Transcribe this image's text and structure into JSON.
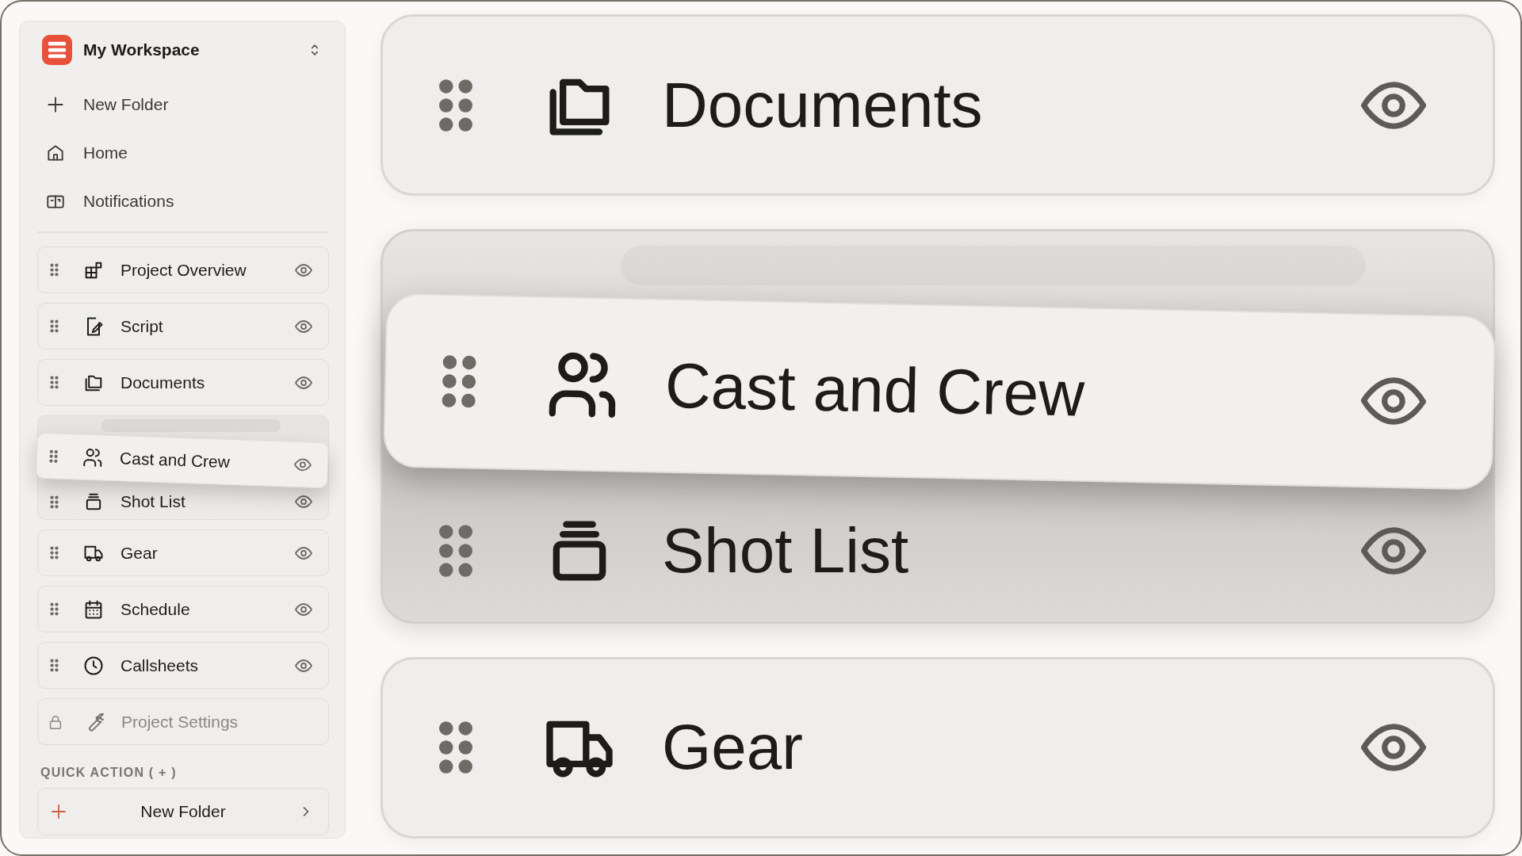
{
  "sidebar": {
    "workspace": {
      "title": "My Workspace"
    },
    "menu": [
      {
        "label": "New Folder"
      },
      {
        "label": "Home"
      },
      {
        "label": "Notifications"
      }
    ],
    "pages": [
      {
        "label": "Project Overview",
        "kind": "item"
      },
      {
        "label": "Script",
        "kind": "item"
      },
      {
        "label": "Documents",
        "kind": "item"
      },
      {
        "kind": "ghost"
      },
      {
        "label": "Cast and Crew",
        "kind": "dragged"
      },
      {
        "label": "Shot List",
        "kind": "item"
      },
      {
        "label": "Gear",
        "kind": "item"
      },
      {
        "label": "Schedule",
        "kind": "item"
      },
      {
        "label": "Callsheets",
        "kind": "item"
      },
      {
        "label": "Project Settings",
        "kind": "locked"
      }
    ],
    "quick_action": {
      "heading": "QUICK ACTION ( + )",
      "button": "New Folder"
    }
  },
  "preview": {
    "items": [
      {
        "label": "Documents",
        "kind": "item"
      },
      {
        "kind": "ghost"
      },
      {
        "label": "Cast and Crew",
        "kind": "dragged"
      },
      {
        "label": "Shot List",
        "kind": "item"
      },
      {
        "label": "Gear",
        "kind": "item"
      }
    ]
  }
}
